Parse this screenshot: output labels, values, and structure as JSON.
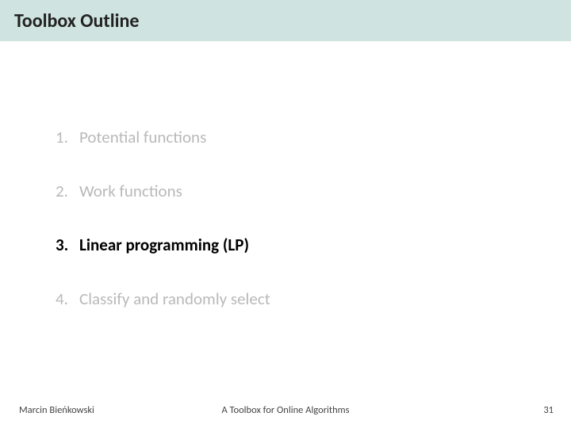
{
  "title": "Toolbox Outline",
  "items": [
    {
      "num": "1.",
      "label": "Potential functions"
    },
    {
      "num": "2.",
      "label": "Work functions"
    },
    {
      "num": "3.",
      "label": "Linear programming (LP)"
    },
    {
      "num": "4.",
      "label": "Classify and randomly select"
    }
  ],
  "footer": {
    "author": "Marcin Bieńkowski",
    "subtitle": "A Toolbox for Online Algorithms",
    "page": "31"
  }
}
